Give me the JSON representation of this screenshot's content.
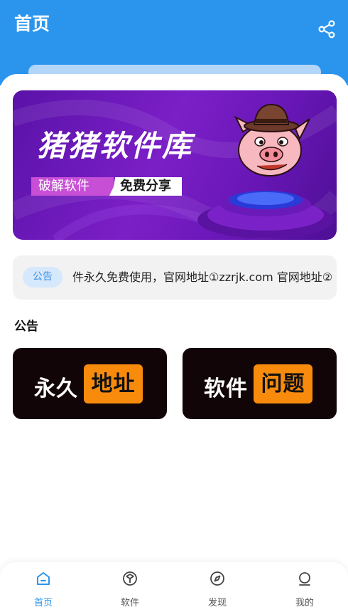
{
  "header": {
    "title": "首页",
    "share_icon": "share-icon",
    "bg_color": "#2b95ee"
  },
  "banner": {
    "title": "猪猪软件库",
    "tag_left": "破解软件",
    "tag_right": "免费分享"
  },
  "notice": {
    "chip_label": "公告",
    "text": "件永久免费使用，官网地址①zzrjk.com 官网地址②"
  },
  "section": {
    "title": "公告"
  },
  "cards": [
    {
      "left_text": "永久",
      "badge_text": "地址"
    },
    {
      "left_text": "软件",
      "badge_text": "问题"
    }
  ],
  "tabbar": {
    "active_color": "#2b95ee",
    "items": [
      {
        "label": "首页",
        "icon": "home-icon",
        "active": true
      },
      {
        "label": "软件",
        "icon": "cube-icon",
        "active": false
      },
      {
        "label": "发现",
        "icon": "compass-icon",
        "active": false
      },
      {
        "label": "我的",
        "icon": "user-icon",
        "active": false
      }
    ]
  }
}
